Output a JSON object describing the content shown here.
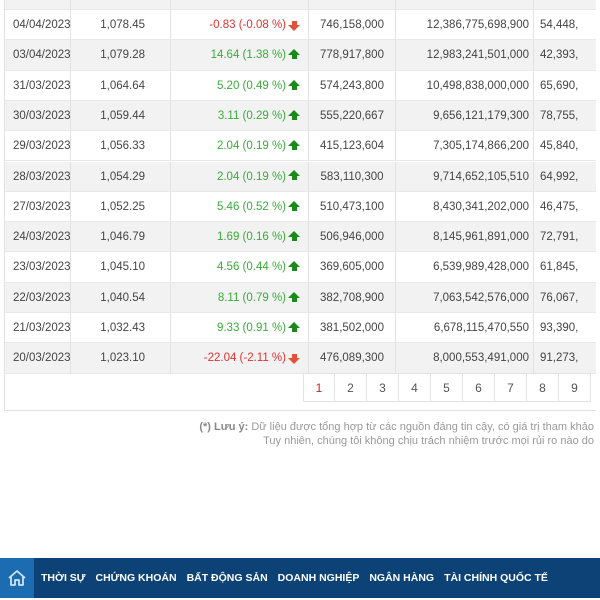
{
  "table": {
    "rows": [
      {
        "date": "04/04/2023",
        "close": "1,078.45",
        "change": "-0.83 (-0.08 %)",
        "dir": "down",
        "volume": "746,158,000",
        "value": "12,386,775,698,900",
        "extra": "54,448,"
      },
      {
        "date": "03/04/2023",
        "close": "1,079.28",
        "change": "14.64 (1.38 %)",
        "dir": "up",
        "volume": "778,917,800",
        "value": "12,983,241,501,000",
        "extra": "42,393,"
      },
      {
        "date": "31/03/2023",
        "close": "1,064.64",
        "change": "5.20 (0.49 %)",
        "dir": "up",
        "volume": "574,243,800",
        "value": "10,498,838,000,000",
        "extra": "65,690,"
      },
      {
        "date": "30/03/2023",
        "close": "1,059.44",
        "change": "3.11 (0.29 %)",
        "dir": "up",
        "volume": "555,220,667",
        "value": "9,656,121,179,300",
        "extra": "78,755,"
      },
      {
        "date": "29/03/2023",
        "close": "1,056.33",
        "change": "2.04 (0.19 %)",
        "dir": "up",
        "volume": "415,123,604",
        "value": "7,305,174,866,200",
        "extra": "45,840,"
      },
      {
        "date": "28/03/2023",
        "close": "1,054.29",
        "change": "2.04 (0.19 %)",
        "dir": "up",
        "volume": "583,110,300",
        "value": "9,714,652,105,510",
        "extra": "64,992,"
      },
      {
        "date": "27/03/2023",
        "close": "1,052.25",
        "change": "5.46 (0.52 %)",
        "dir": "up",
        "volume": "510,473,100",
        "value": "8,430,341,202,000",
        "extra": "46,475,"
      },
      {
        "date": "24/03/2023",
        "close": "1,046.79",
        "change": "1.69 (0.16 %)",
        "dir": "up",
        "volume": "506,946,000",
        "value": "8,145,961,891,000",
        "extra": "72,791,"
      },
      {
        "date": "23/03/2023",
        "close": "1,045.10",
        "change": "4.56 (0.44 %)",
        "dir": "up",
        "volume": "369,605,000",
        "value": "6,539,989,428,000",
        "extra": "61,845,"
      },
      {
        "date": "22/03/2023",
        "close": "1,040.54",
        "change": "8.11 (0.79 %)",
        "dir": "up",
        "volume": "382,708,900",
        "value": "7,063,542,576,000",
        "extra": "76,067,"
      },
      {
        "date": "21/03/2023",
        "close": "1,032.43",
        "change": "9.33 (0.91 %)",
        "dir": "up",
        "volume": "381,502,000",
        "value": "6,678,115,470,550",
        "extra": "93,390,"
      },
      {
        "date": "20/03/2023",
        "close": "1,023.10",
        "change": "-22.04 (-2.11 %)",
        "dir": "down",
        "volume": "476,089,300",
        "value": "8,000,553,491,000",
        "extra": "91,273,"
      }
    ]
  },
  "pagination": {
    "pages": [
      "1",
      "2",
      "3",
      "4",
      "5",
      "6",
      "7",
      "8",
      "9"
    ],
    "current": "1"
  },
  "note": {
    "label": "(*) Lưu ý:",
    "line1": " Dữ liệu được tổng hợp từ các nguồn đáng tin cậy, có giá trị tham khảo",
    "line2": "Tuy nhiên, chúng tôi không chịu trách nhiệm trước mọi rủi ro nào do"
  },
  "nav": {
    "items": [
      "THỜI SỰ",
      "CHỨNG KHOÁN",
      "BẤT ĐỘNG SẢN",
      "DOANH NGHIỆP",
      "NGÂN HÀNG",
      "TÀI CHÍNH QUỐC TẾ"
    ]
  },
  "colors": {
    "up": "#3aab3a",
    "down": "#dd3333",
    "nav": "#0c4275",
    "home": "#1b6cb0",
    "current_page": "#c4242b"
  }
}
